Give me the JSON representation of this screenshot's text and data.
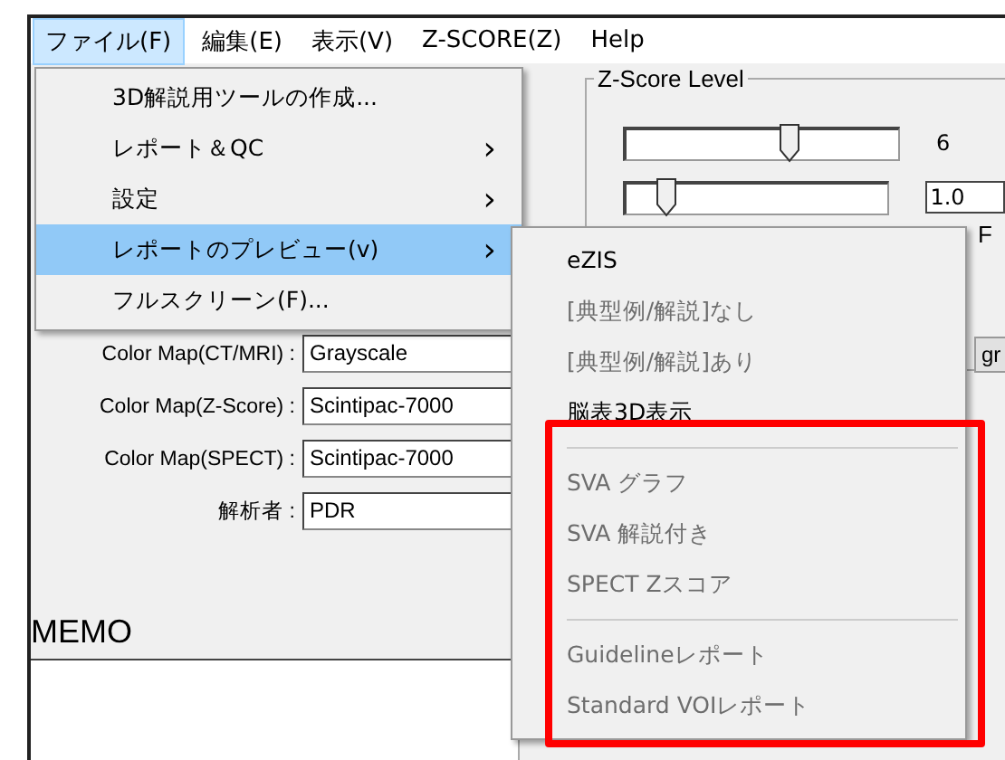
{
  "menubar": [
    {
      "label": "ファイル(F)",
      "selected": true
    },
    {
      "label": "編集(E)",
      "selected": false
    },
    {
      "label": "表示(V)",
      "selected": false
    },
    {
      "label": "Z-SCORE(Z)",
      "selected": false
    },
    {
      "label": "Help",
      "selected": false
    }
  ],
  "file_menu": [
    {
      "label": "3D解説用ツールの作成...",
      "submenu": false,
      "selected": false
    },
    {
      "label": "レポート＆QC",
      "submenu": true,
      "selected": false
    },
    {
      "label": "設定",
      "submenu": true,
      "selected": false
    },
    {
      "label": "レポートのプレビュー(v)",
      "submenu": true,
      "selected": true
    },
    {
      "label": "フルスクリーン(F)...",
      "submenu": false,
      "selected": false
    }
  ],
  "submenu_arrow": "›",
  "preview_submenu": [
    {
      "kind": "item",
      "label": "eZIS",
      "disabled": false
    },
    {
      "kind": "item",
      "label": "[典型例/解説]なし",
      "disabled": true
    },
    {
      "kind": "item",
      "label": "[典型例/解説]あり",
      "disabled": true
    },
    {
      "kind": "item",
      "label": "脳表3D表示",
      "disabled": false
    },
    {
      "kind": "separator"
    },
    {
      "kind": "item",
      "label": "SVA グラフ",
      "disabled": true
    },
    {
      "kind": "item",
      "label": "SVA 解説付き",
      "disabled": true
    },
    {
      "kind": "item",
      "label": "SPECT Zスコア",
      "disabled": true
    },
    {
      "kind": "separator"
    },
    {
      "kind": "item",
      "label": "Guidelineレポート",
      "disabled": true
    },
    {
      "kind": "item",
      "label": "Standard VOIレポート",
      "disabled": true
    }
  ],
  "zscore_group": {
    "title": "Z-Score Level",
    "sliders": [
      {
        "kind": "label",
        "level": 0.6,
        "value": "6"
      },
      {
        "kind": "field",
        "level": 0.15,
        "value": "1.0"
      }
    ]
  },
  "form": [
    {
      "label": "Color Map(CT/MRI) :",
      "value": "Grayscale"
    },
    {
      "label": "Color Map(Z-Score) :",
      "value": "Scintipac-7000"
    },
    {
      "label": "Color Map(SPECT) :",
      "value": "Scintipac-7000"
    },
    {
      "label": "解析者 :",
      "value": "PDR"
    }
  ],
  "memo_label": "MEMO",
  "edge_fragments": [
    "F",
    "gr"
  ]
}
